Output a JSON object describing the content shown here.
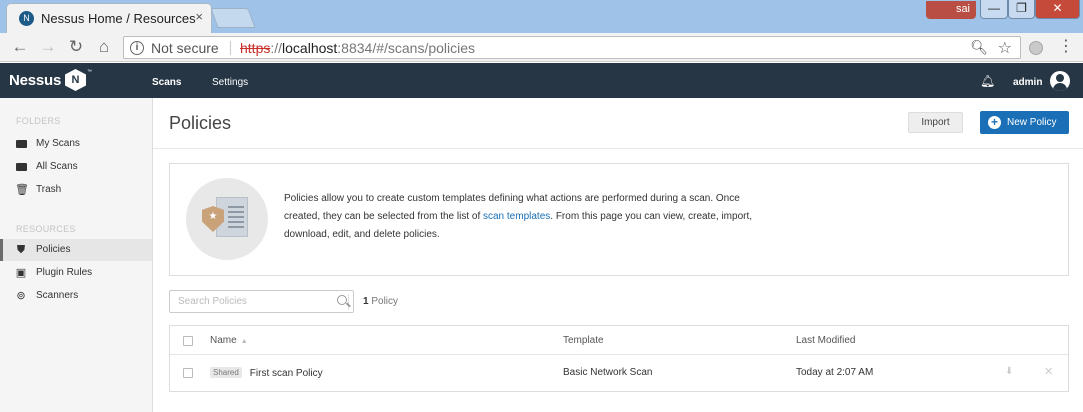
{
  "browser": {
    "tab_title": "Nessus Home / Resources",
    "tab_close": "×",
    "user_badge": "sai",
    "window": {
      "minimize": "—",
      "maximize": "❐",
      "close": "✕"
    },
    "nav": {
      "back": "←",
      "forward": "→",
      "reload": "↻",
      "home": "⌂"
    },
    "security_label": "Not secure",
    "url": {
      "scheme": "https",
      "separator": "://",
      "host": "localhost",
      "path": ":8834/#/scans/policies"
    }
  },
  "app": {
    "logo_text": "Nessus",
    "logo_badge": "N",
    "logo_tm": "™",
    "nav": {
      "scans": "Scans",
      "settings": "Settings"
    },
    "user": "admin"
  },
  "sidebar": {
    "folders_heading": "FOLDERS",
    "folders": [
      {
        "label": "My Scans",
        "icon": "folder-icon"
      },
      {
        "label": "All Scans",
        "icon": "folder-icon"
      },
      {
        "label": "Trash",
        "icon": "trash-icon"
      }
    ],
    "resources_heading": "RESOURCES",
    "resources": [
      {
        "label": "Policies",
        "icon": "shield-icon",
        "active": true
      },
      {
        "label": "Plugin Rules",
        "icon": "plugin-rules-icon"
      },
      {
        "label": "Scanners",
        "icon": "scanner-icon"
      }
    ]
  },
  "main": {
    "title": "Policies",
    "import_label": "Import",
    "new_policy_label": "New Policy",
    "info": {
      "text_before": "Policies allow you to create custom templates defining what actions are performed during a scan. Once created, they can be selected from the list of ",
      "link": "scan templates",
      "text_after": ". From this page you can view, create, import, download, edit, and delete policies."
    },
    "search_placeholder": "Search Policies",
    "count_number": "1",
    "count_label": "Policy",
    "table": {
      "headers": {
        "name": "Name",
        "template": "Template",
        "last_modified": "Last Modified"
      },
      "rows": [
        {
          "badge": "Shared",
          "name": "First scan Policy",
          "template": "Basic Network Scan",
          "last_modified": "Today at 2:07 AM"
        }
      ]
    }
  }
}
